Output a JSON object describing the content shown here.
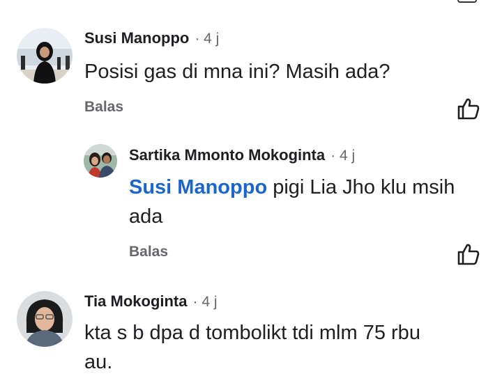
{
  "comments": [
    {
      "author": "Susi Manoppo",
      "meta": "· 4 j",
      "text": "Posisi gas di mna ini? Masih ada?",
      "reply_label": "Balas",
      "like_icon": "thumbs-up-icon"
    },
    {
      "author": "Sartika Mmonto Mokoginta",
      "meta": "· 4 j",
      "mention": "Susi Manoppo",
      "text_line1": " pigi Lia Jho klu msih",
      "text_line2": "ada",
      "reply_label": "Balas",
      "like_icon": "thumbs-up-icon"
    },
    {
      "author": "Tia Mokoginta",
      "meta": "· 4 j",
      "text_line1": "kta s b dpa d tombolikt tdi mlm 75 rbu",
      "text_line2": "au."
    }
  ],
  "colors": {
    "mention": "#1a66cc",
    "secondary_text": "#65676b",
    "primary_text": "#1c1e21"
  }
}
